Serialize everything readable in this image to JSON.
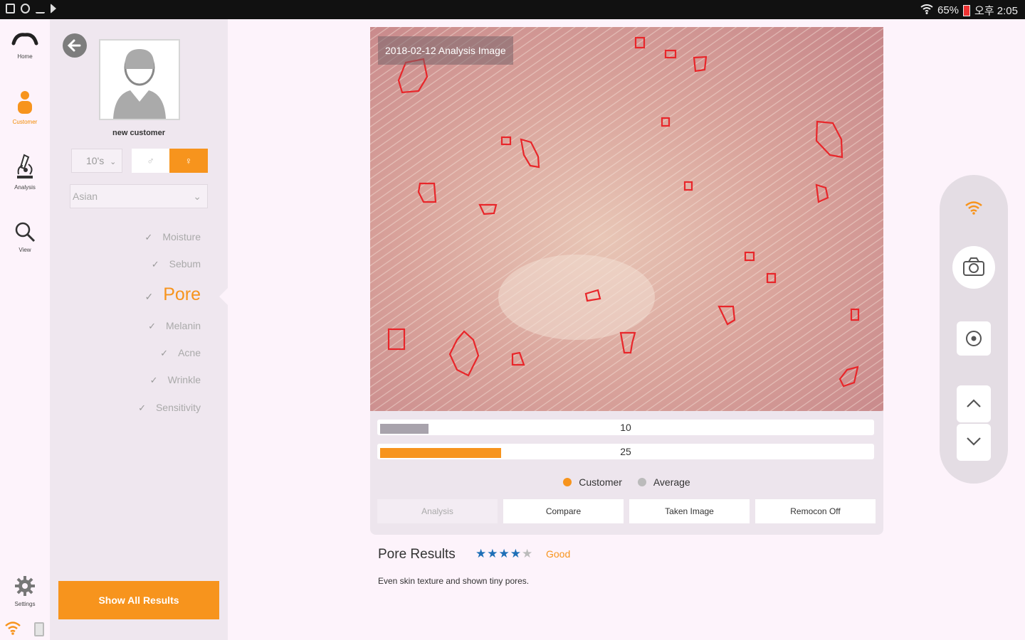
{
  "status_bar": {
    "right_text": "65%",
    "time": "오후 2:05"
  },
  "rail": {
    "items": [
      {
        "label": "Home"
      },
      {
        "label": "Customer"
      },
      {
        "label": "Analysis"
      },
      {
        "label": "View"
      },
      {
        "label": "Settings"
      }
    ]
  },
  "customer": {
    "name": "new customer",
    "age": "10's",
    "ethnicity": "Asian",
    "categories": [
      "Moisture",
      "Sebum",
      "Pore",
      "Melanin",
      "Acne",
      "Wrinkle",
      "Sensitivity"
    ],
    "active_category": "Pore",
    "show_all_label": "Show All Results"
  },
  "analysis": {
    "image_label": "2018-02-12 Analysis Image",
    "average_value": "10",
    "customer_value": "25",
    "average_fill_fraction": 0.1,
    "customer_fill_fraction": 0.25,
    "legend_customer": "Customer",
    "legend_average": "Average",
    "tabs": [
      "Analysis",
      "Compare",
      "Taken Image",
      "Remocon Off"
    ]
  },
  "results": {
    "title": "Pore Results",
    "rating": 4,
    "rating_max": 5,
    "grade": "Good",
    "description": "Even skin texture and shown tiny pores."
  },
  "colors": {
    "accent": "#f7941d",
    "average_bar": "#a8a3ac",
    "star": "#1e6fb7",
    "pore_outline": "#e8262a"
  }
}
